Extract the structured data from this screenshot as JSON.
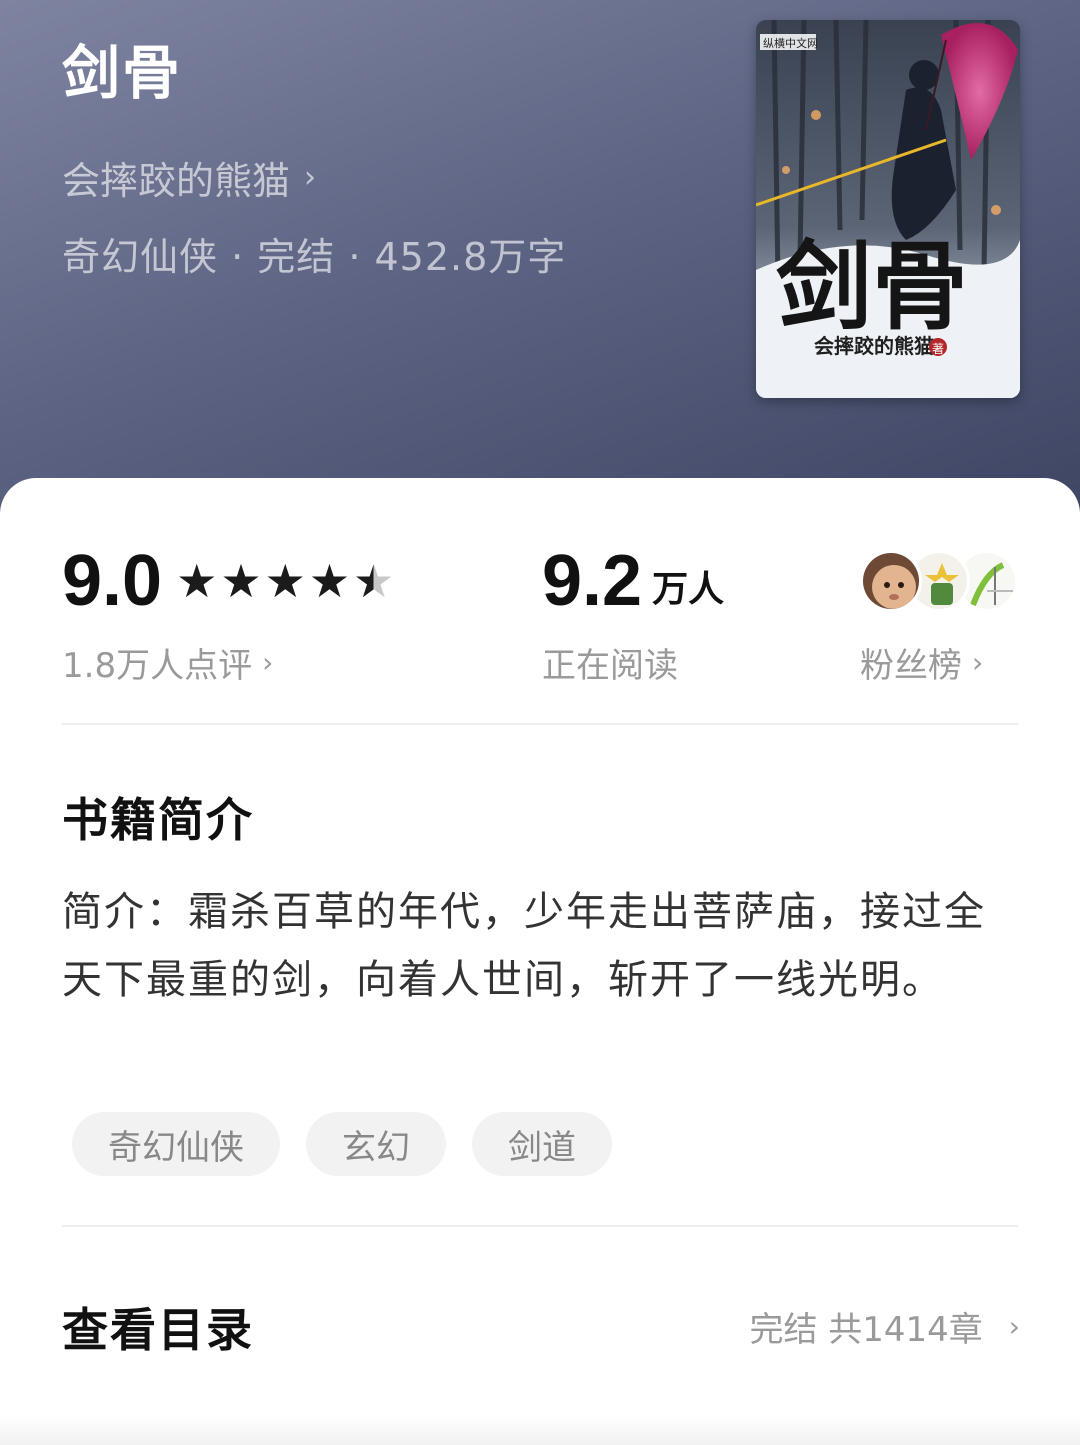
{
  "book": {
    "title": "剑骨",
    "author": "会摔跤的熊猫",
    "meta": "奇幻仙侠 · 完结 · 452.8万字",
    "cover": {
      "title": "剑骨",
      "author": "会摔跤的熊猫",
      "author_suffix": "著",
      "publisher": "纵横中文网"
    }
  },
  "stats": {
    "rating": {
      "value": "9.0",
      "stars": 4.5,
      "stars_max": 5,
      "reviews_label": "1.8万人点评"
    },
    "readers": {
      "value": "9.2",
      "unit": "万人",
      "label": "正在阅读"
    },
    "fans": {
      "label": "粉丝榜",
      "avatars": [
        "avatar-baby-face",
        "avatar-plant",
        "avatar-grass"
      ]
    }
  },
  "intro": {
    "heading": "书籍简介",
    "text": "简介：霜杀百草的年代，少年走出菩萨庙，接过全天下最重的剑，向着人世间，斩开了一线光明。",
    "tags": [
      "奇幻仙侠",
      "玄幻",
      "剑道"
    ]
  },
  "toc": {
    "heading": "查看目录",
    "status": "完结 共1414章"
  },
  "icons": {
    "chevron": "chevron-right-icon",
    "star": "star-icon"
  },
  "colors": {
    "header_gradient_start": "#7e84a0",
    "header_gradient_end": "#3d4563",
    "star": "#1b1b1b",
    "tag_bg": "#f2f2f2"
  }
}
